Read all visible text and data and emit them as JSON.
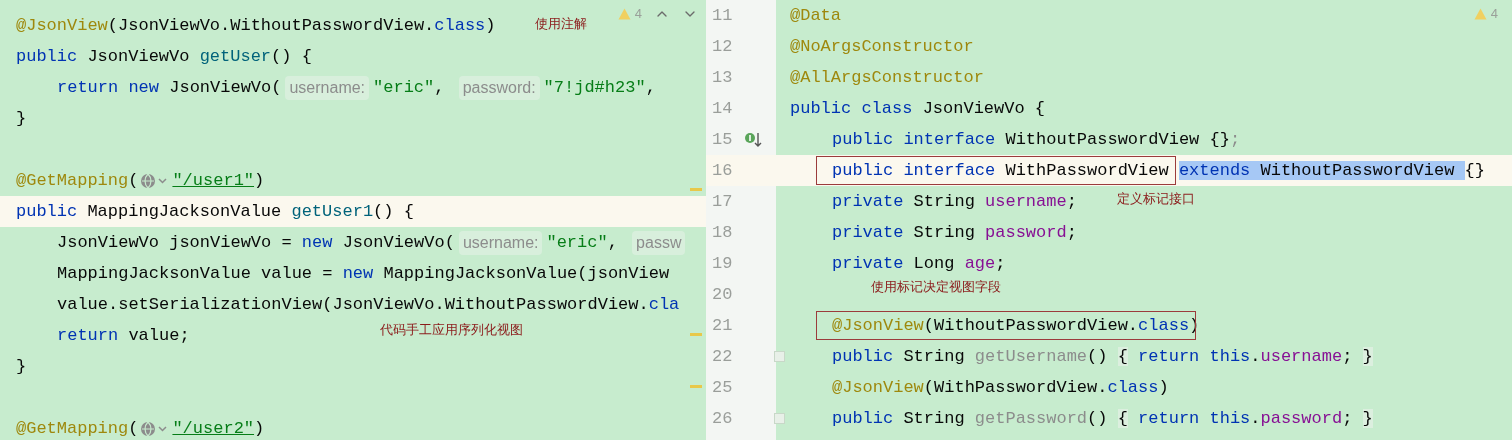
{
  "left_pane": {
    "toolbar": {
      "warnings": "4"
    },
    "notes": [
      "使用注解",
      "代码手工应用序列化视图"
    ],
    "lines": [
      {
        "current": false,
        "indent": false,
        "tokens": [
          {
            "t": "@JsonView",
            "kind": "ann"
          },
          {
            "t": "(JsonViewVo.WithoutPasswordView.",
            "kind": "plain"
          },
          {
            "t": "class",
            "kind": "kw"
          },
          {
            "t": ")",
            "kind": "plain"
          }
        ]
      },
      {
        "current": false,
        "indent": false,
        "tokens": [
          {
            "t": "public",
            "kind": "kw"
          },
          {
            "t": " JsonViewVo ",
            "kind": "plain"
          },
          {
            "t": "getUser",
            "kind": "fn"
          },
          {
            "t": "() {",
            "kind": "plain"
          }
        ]
      },
      {
        "current": false,
        "indent": true,
        "tokens": [
          {
            "t": "return",
            "kind": "kw"
          },
          {
            "t": " new",
            "kind": "kw"
          },
          {
            "t": " JsonViewVo(",
            "kind": "plain"
          },
          {
            "t": "username:",
            "kind": "hint"
          },
          {
            "t": "\"eric\"",
            "kind": "str"
          },
          {
            "t": ", ",
            "kind": "plain"
          },
          {
            "t": "password:",
            "kind": "hint"
          },
          {
            "t": "\"7!jd#h23\"",
            "kind": "str"
          },
          {
            "t": ",",
            "kind": "plain"
          }
        ]
      },
      {
        "current": false,
        "indent": false,
        "tokens": [
          {
            "t": "}",
            "kind": "plain"
          }
        ]
      },
      {
        "current": false
      },
      {
        "current": false,
        "indent": false,
        "tokens": [
          {
            "t": "@GetMapping",
            "kind": "ann"
          },
          {
            "t": "(",
            "kind": "plain"
          },
          {
            "kind": "globe"
          },
          {
            "t": "\"/user1\"",
            "kind": "url"
          },
          {
            "t": ")",
            "kind": "plain"
          }
        ]
      },
      {
        "current": true,
        "indent": false,
        "tokens": [
          {
            "t": "public",
            "kind": "kw"
          },
          {
            "t": " MappingJacksonValue ",
            "kind": "plain"
          },
          {
            "t": "getUser1",
            "kind": "fn"
          },
          {
            "t": "() {",
            "kind": "plain"
          }
        ]
      },
      {
        "current": false,
        "indent": true,
        "tokens": [
          {
            "t": "JsonViewVo jsonViewVo = ",
            "kind": "plain"
          },
          {
            "t": "new",
            "kind": "kw"
          },
          {
            "t": " JsonViewVo(",
            "kind": "plain"
          },
          {
            "t": "username:",
            "kind": "hint"
          },
          {
            "t": "\"eric\"",
            "kind": "str"
          },
          {
            "t": ", ",
            "kind": "plain"
          },
          {
            "t": "passw",
            "kind": "hint"
          }
        ]
      },
      {
        "current": false,
        "indent": true,
        "tokens": [
          {
            "t": "MappingJacksonValue value = ",
            "kind": "plain"
          },
          {
            "t": "new",
            "kind": "kw"
          },
          {
            "t": " MappingJacksonValue(jsonView",
            "kind": "plain"
          }
        ]
      },
      {
        "current": false,
        "indent": true,
        "tokens": [
          {
            "t": "value.setSerializationView(JsonViewVo.WithoutPasswordView.",
            "kind": "plain"
          },
          {
            "t": "cla",
            "kind": "kw"
          }
        ]
      },
      {
        "current": false,
        "indent": true,
        "tokens": [
          {
            "t": "return",
            "kind": "kw"
          },
          {
            "t": " value;",
            "kind": "plain"
          }
        ]
      },
      {
        "current": false,
        "indent": false,
        "tokens": [
          {
            "t": "}",
            "kind": "plain"
          }
        ]
      },
      {
        "current": false
      },
      {
        "current": false,
        "indent": false,
        "tokens": [
          {
            "t": "@GetMapping",
            "kind": "ann"
          },
          {
            "t": "(",
            "kind": "plain"
          },
          {
            "kind": "globe"
          },
          {
            "t": "\"/user2\"",
            "kind": "url"
          },
          {
            "t": ")",
            "kind": "plain"
          }
        ]
      }
    ]
  },
  "right_pane": {
    "toolbar": {
      "warnings": "4"
    },
    "notes": [
      "定义标记接口",
      "使用标记决定视图字段"
    ],
    "lines": [
      {
        "number": "11",
        "current": false,
        "indent": false,
        "framed": false,
        "tokens": [
          {
            "t": "@Data",
            "kind": "ann"
          }
        ]
      },
      {
        "number": "12",
        "current": false,
        "indent": false,
        "framed": false,
        "tokens": [
          {
            "t": "@NoArgsConstructor",
            "kind": "ann"
          }
        ]
      },
      {
        "number": "13",
        "current": false,
        "indent": false,
        "framed": false,
        "tokens": [
          {
            "t": "@AllArgsConstructor",
            "kind": "ann"
          }
        ]
      },
      {
        "number": "14",
        "current": false,
        "indent": false,
        "framed": false,
        "tokens": [
          {
            "t": "public",
            "kind": "kw"
          },
          {
            "t": " class",
            "kind": "kw"
          },
          {
            "t": " JsonViewVo {",
            "kind": "plain"
          }
        ]
      },
      {
        "number": "15",
        "current": false,
        "indent": true,
        "framed": false,
        "kind": "implemented",
        "tokens": [
          {
            "t": "public",
            "kind": "kw"
          },
          {
            "t": " interface",
            "kind": "kw"
          },
          {
            "t": " WithoutPasswordView {}",
            "kind": "plain"
          },
          {
            "t": ";",
            "kind": "unused"
          }
        ]
      },
      {
        "number": "16",
        "current": true,
        "indent": true,
        "framed": true,
        "tokens": [
          {
            "t": "public",
            "kind": "kw",
            "selected": false
          },
          {
            "t": " interface",
            "kind": "kw",
            "selected": false
          },
          {
            "t": " WithPasswordView ",
            "kind": "plain",
            "selected": false
          },
          {
            "t": "extends",
            "kind": "kw",
            "selected": true
          },
          {
            "t": " WithoutPasswordView ",
            "kind": "plain",
            "selected": true
          },
          {
            "t": "{}",
            "kind": "plain",
            "selected": false
          }
        ]
      },
      {
        "number": "17",
        "current": false,
        "indent": true,
        "framed": false,
        "tokens": [
          {
            "t": "private",
            "kind": "kw"
          },
          {
            "t": " String ",
            "kind": "plain"
          },
          {
            "t": "username",
            "kind": "field"
          },
          {
            "t": ";",
            "kind": "plain"
          }
        ]
      },
      {
        "number": "18",
        "current": false,
        "indent": true,
        "framed": false,
        "tokens": [
          {
            "t": "private",
            "kind": "kw"
          },
          {
            "t": " String ",
            "kind": "plain"
          },
          {
            "t": "password",
            "kind": "field"
          },
          {
            "t": ";",
            "kind": "plain"
          }
        ]
      },
      {
        "number": "19",
        "current": false,
        "indent": true,
        "framed": false,
        "tokens": [
          {
            "t": "private",
            "kind": "kw"
          },
          {
            "t": " Long ",
            "kind": "plain"
          },
          {
            "t": "age",
            "kind": "field"
          },
          {
            "t": ";",
            "kind": "plain"
          }
        ]
      },
      {
        "number": "20",
        "current": false,
        "framed": false
      },
      {
        "number": "21",
        "current": false,
        "indent": true,
        "framed": true,
        "tokens": [
          {
            "t": "@JsonView",
            "kind": "ann"
          },
          {
            "t": "(WithoutPasswordView.",
            "kind": "plain"
          },
          {
            "t": "class",
            "kind": "kw"
          },
          {
            "t": ")",
            "kind": "plain"
          }
        ]
      },
      {
        "number": "22",
        "current": false,
        "indent": true,
        "framed": false,
        "kind": "fold",
        "tokens": [
          {
            "t": "public",
            "kind": "kw"
          },
          {
            "t": " String ",
            "kind": "plain"
          },
          {
            "t": "getUsername",
            "kind": "unused"
          },
          {
            "t": "() ",
            "kind": "plain"
          },
          {
            "t": "{",
            "kind": "brace"
          },
          {
            "t": " return",
            "kind": "kw"
          },
          {
            "t": " this",
            "kind": "kw"
          },
          {
            "t": ".",
            "kind": "plain"
          },
          {
            "t": "username",
            "kind": "field"
          },
          {
            "t": "; ",
            "kind": "plain"
          },
          {
            "t": "}",
            "kind": "brace"
          }
        ]
      },
      {
        "number": "25",
        "current": false,
        "indent": true,
        "framed": false,
        "tokens": [
          {
            "t": "@JsonView",
            "kind": "ann"
          },
          {
            "t": "(WithPasswordView.",
            "kind": "plain"
          },
          {
            "t": "class",
            "kind": "kw"
          },
          {
            "t": ")",
            "kind": "plain"
          }
        ]
      },
      {
        "number": "26",
        "current": false,
        "indent": true,
        "framed": false,
        "kind": "fold",
        "tokens": [
          {
            "t": "public",
            "kind": "kw"
          },
          {
            "t": " String ",
            "kind": "plain"
          },
          {
            "t": "getPassword",
            "kind": "unused"
          },
          {
            "t": "() ",
            "kind": "plain"
          },
          {
            "t": "{",
            "kind": "brace"
          },
          {
            "t": " return",
            "kind": "kw"
          },
          {
            "t": " this",
            "kind": "kw"
          },
          {
            "t": ".",
            "kind": "plain"
          },
          {
            "t": "password",
            "kind": "field"
          },
          {
            "t": "; ",
            "kind": "plain"
          },
          {
            "t": "}",
            "kind": "brace"
          }
        ]
      }
    ]
  }
}
